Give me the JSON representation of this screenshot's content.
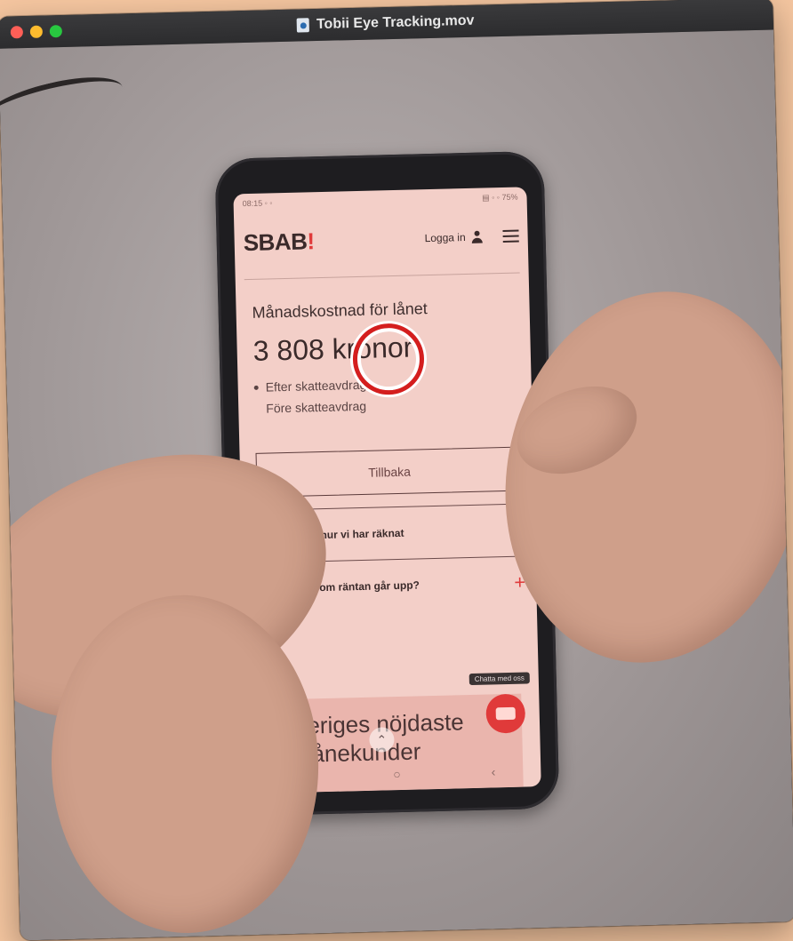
{
  "window": {
    "title": "Tobii Eye Tracking.mov"
  },
  "phone": {
    "status_left": "08:15 ◦ ◦",
    "status_right": "▤ ◦ ◦ 75%",
    "header": {
      "logo_text": "SBAB",
      "logo_mark": "!",
      "login_label": "Logga in"
    },
    "monthly_cost_label": "Månadskostnad för lånet",
    "monthly_cost_value": "3 808 kronor",
    "tax_options": [
      "Efter skatteavdrag",
      "Före skatteavdrag"
    ],
    "back_button": "Tillbaka",
    "accordion": [
      {
        "label": "Läs mer om hur vi har räknat",
        "icon": "+"
      },
      {
        "label": "Vad händer om räntan går upp?",
        "icon": "+"
      }
    ],
    "chat_tooltip": "Chatta med oss",
    "promo_text": "Sveriges nöjdaste bolånekunder",
    "nav": [
      "|||",
      "○",
      "‹"
    ]
  },
  "colors": {
    "brand_red": "#e03a3a",
    "gaze_ring": "#d41e1e"
  }
}
